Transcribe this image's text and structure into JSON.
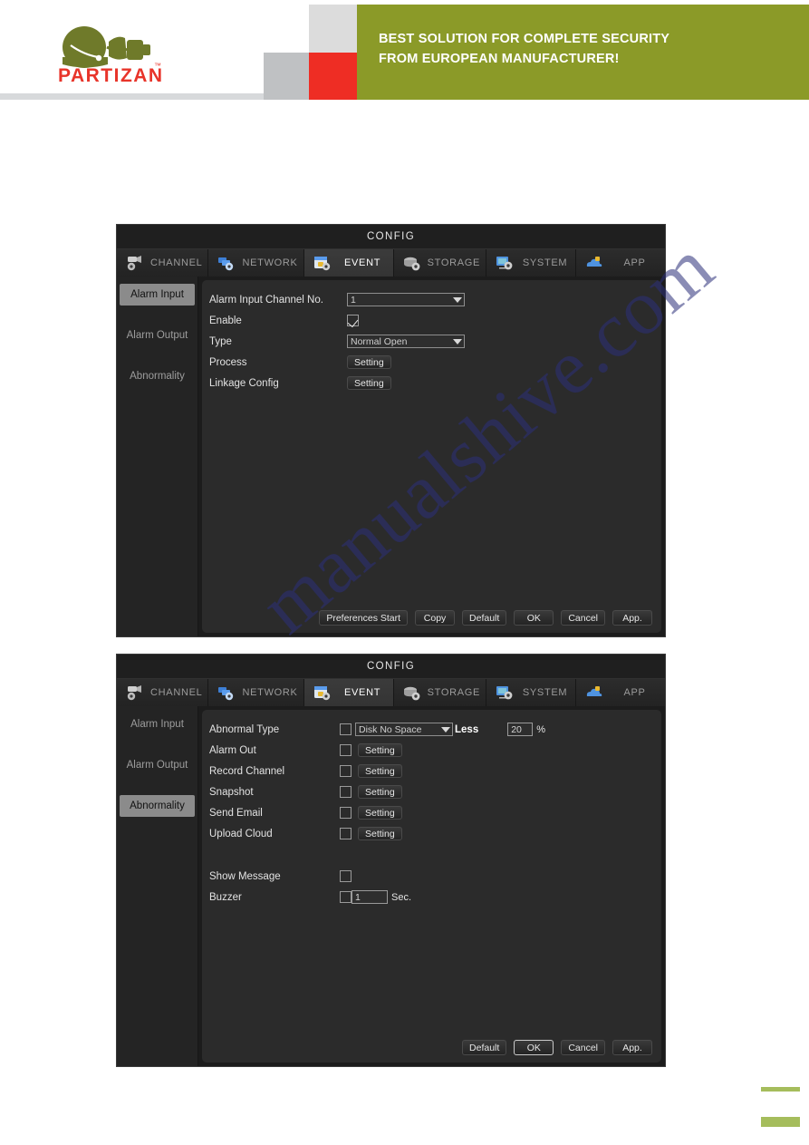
{
  "header": {
    "tagline_line1": "BEST SOLUTION FOR COMPLETE SECURITY",
    "tagline_line2": "FROM EUROPEAN MANUFACTURER!",
    "logo_text": "PARTIZAN",
    "logo_tm": "™",
    "colors": {
      "green": "#8b9a28",
      "red": "#ee2d24",
      "light_gray": "#dcdcdc",
      "medium_gray": "#bfc1c3",
      "logo_red": "#e8342a",
      "logo_olive": "#6f7a2a"
    }
  },
  "watermark": {
    "text": "manualshive.com"
  },
  "dialog1": {
    "title": "CONFIG",
    "tabs": [
      {
        "label": "CHANNEL",
        "icon": "camera-gear-icon",
        "active": false
      },
      {
        "label": "NETWORK",
        "icon": "network-gear-icon",
        "active": false
      },
      {
        "label": "EVENT",
        "icon": "event-shield-icon",
        "active": true
      },
      {
        "label": "STORAGE",
        "icon": "storage-gear-icon",
        "active": false
      },
      {
        "label": "SYSTEM",
        "icon": "system-monitor-gear-icon",
        "active": false
      },
      {
        "label": "APP",
        "icon": "app-cloud-icon",
        "active": false
      }
    ],
    "sidebar": [
      {
        "label": "Alarm Input",
        "active": true
      },
      {
        "label": "Alarm Output",
        "active": false
      },
      {
        "label": "Abnormality",
        "active": false
      }
    ],
    "fields": {
      "channel_label": "Alarm Input Channel No.",
      "channel_value": "1",
      "enable_label": "Enable",
      "enable_checked": true,
      "type_label": "Type",
      "type_value": "Normal Open",
      "process_label": "Process",
      "process_button": "Setting",
      "linkage_label": "Linkage Config",
      "linkage_button": "Setting"
    },
    "buttons": [
      {
        "label": "Preferences Start",
        "focused": false
      },
      {
        "label": "Copy",
        "focused": false
      },
      {
        "label": "Default",
        "focused": false
      },
      {
        "label": "OK",
        "focused": false
      },
      {
        "label": "Cancel",
        "focused": false
      },
      {
        "label": "App.",
        "focused": false
      }
    ]
  },
  "dialog2": {
    "title": "CONFIG",
    "tabs": [
      {
        "label": "CHANNEL",
        "icon": "camera-gear-icon",
        "active": false
      },
      {
        "label": "NETWORK",
        "icon": "network-gear-icon",
        "active": false
      },
      {
        "label": "EVENT",
        "icon": "event-shield-icon",
        "active": true
      },
      {
        "label": "STORAGE",
        "icon": "storage-gear-icon",
        "active": false
      },
      {
        "label": "SYSTEM",
        "icon": "system-monitor-gear-icon",
        "active": false
      },
      {
        "label": "APP",
        "icon": "app-cloud-icon",
        "active": false
      }
    ],
    "sidebar": [
      {
        "label": "Alarm Input",
        "active": false
      },
      {
        "label": "Alarm Output",
        "active": false
      },
      {
        "label": "Abnormality",
        "active": true
      }
    ],
    "fields": {
      "abnormal_type_label": "Abnormal Type",
      "abnormal_type_value": "Disk No Space",
      "abnormal_type_checked": false,
      "less_label": "Less",
      "less_value": "20",
      "percent_unit": "%",
      "alarm_out_label": "Alarm Out",
      "alarm_out_button": "Setting",
      "record_channel_label": "Record Channel",
      "record_channel_button": "Setting",
      "snapshot_label": "Snapshot",
      "snapshot_button": "Setting",
      "send_email_label": "Send Email",
      "send_email_button": "Setting",
      "upload_cloud_label": "Upload Cloud",
      "upload_cloud_button": "Setting",
      "show_message_label": "Show Message",
      "buzzer_label": "Buzzer",
      "buzzer_value": "1",
      "buzzer_unit": "Sec."
    },
    "buttons": [
      {
        "label": "Default",
        "focused": false
      },
      {
        "label": "OK",
        "focused": true
      },
      {
        "label": "Cancel",
        "focused": false
      },
      {
        "label": "App.",
        "focused": false
      }
    ]
  }
}
